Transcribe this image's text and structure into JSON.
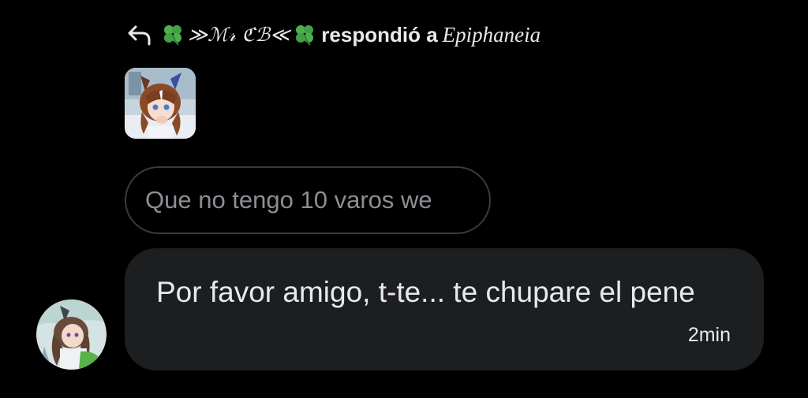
{
  "reply_header": {
    "icon": "reply-arrow-icon",
    "sender_name": "≫ℳ𝓇 ℭℬ≪",
    "sender_decoration_icon": "four-leaf-clover-icon",
    "action_text": "respondió a",
    "target_name": "Epiphaneia"
  },
  "story": {
    "thumbnail_icon": "story-thumbnail-image"
  },
  "quoted_story_text": "Que no tengo 10 varos we",
  "message": {
    "text": "Por favor amigo, t-te... te chupare el pene",
    "time": "2min"
  },
  "sender_avatar": {
    "icon": "avatar-image"
  },
  "colors": {
    "background": "#000000",
    "bubble": "#1d1e20",
    "text": "#e7e9ea",
    "muted_text": "#8b8f93",
    "pill_border": "#3a3b3d",
    "clover": "#4caf50"
  }
}
